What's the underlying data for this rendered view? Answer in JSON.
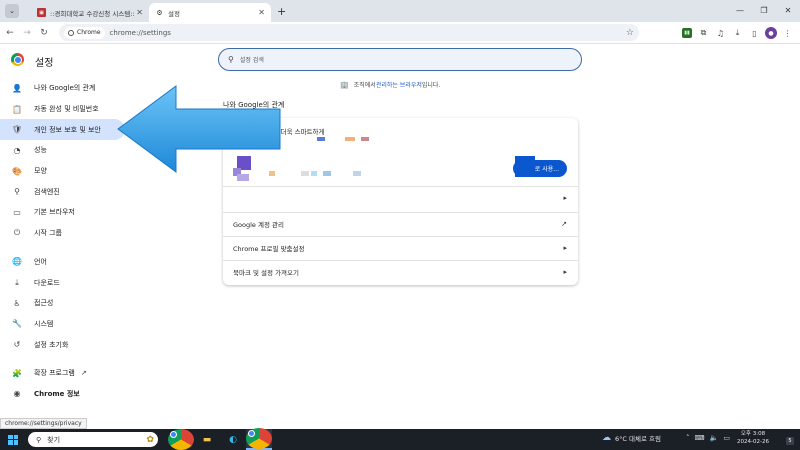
{
  "tabs": [
    {
      "title": "::경희대학교 수강신청 시스템::",
      "active": false
    },
    {
      "title": "설정",
      "active": true
    }
  ],
  "toolbar": {
    "chip": "Chrome",
    "url": "chrome://settings"
  },
  "settings": {
    "title": "설정",
    "search_placeholder": "설정 검색"
  },
  "sidebar": {
    "items": [
      {
        "label": "나와 Google의 관계",
        "icon": "person-icon"
      },
      {
        "label": "자동 완성 및 비밀번호",
        "icon": "clipboard-icon"
      },
      {
        "label": "개인 정보 보호 및 보안",
        "icon": "shield-icon"
      },
      {
        "label": "성능",
        "icon": "speedometer-icon"
      },
      {
        "label": "모양",
        "icon": "palette-icon"
      },
      {
        "label": "검색엔진",
        "icon": "search-icon"
      },
      {
        "label": "기본 브라우저",
        "icon": "browser-icon"
      },
      {
        "label": "시작 그룹",
        "icon": "power-icon"
      },
      {
        "label": "언어",
        "icon": "globe-icon"
      },
      {
        "label": "다운로드",
        "icon": "download-icon"
      },
      {
        "label": "접근성",
        "icon": "accessibility-icon"
      },
      {
        "label": "시스템",
        "icon": "wrench-icon"
      },
      {
        "label": "설정 초기화",
        "icon": "reset-icon"
      },
      {
        "label": "확장 프로그램",
        "icon": "puzzle-icon"
      },
      {
        "label": "Chrome 정보",
        "icon": "chrome-icon"
      }
    ]
  },
  "main": {
    "managed_prefix": "조직에서 ",
    "managed_link": "관리하는 브라우저",
    "managed_suffix": "입니다.",
    "section_title": "나와 Google의 관계",
    "promo_text": "e로 Chrome을 더욱 스마트하게",
    "sync_button": "로 사용...",
    "rows": [
      {
        "label": "Google 계정 관리"
      },
      {
        "label": "Chrome 프로필 맞춤설정"
      },
      {
        "label": "북마크 및 설정 가져오기"
      }
    ]
  },
  "status_url": "chrome://settings/privacy",
  "taskbar": {
    "search_label": "찾기",
    "weather": "6°C  대체로 흐림",
    "time": "오후 3:08",
    "date": "2024-02-26",
    "notifications": "5"
  },
  "colors": {
    "active_nav": "#d3e3fd",
    "accent": "#0b57d0",
    "arrow": "#2f9be8"
  }
}
